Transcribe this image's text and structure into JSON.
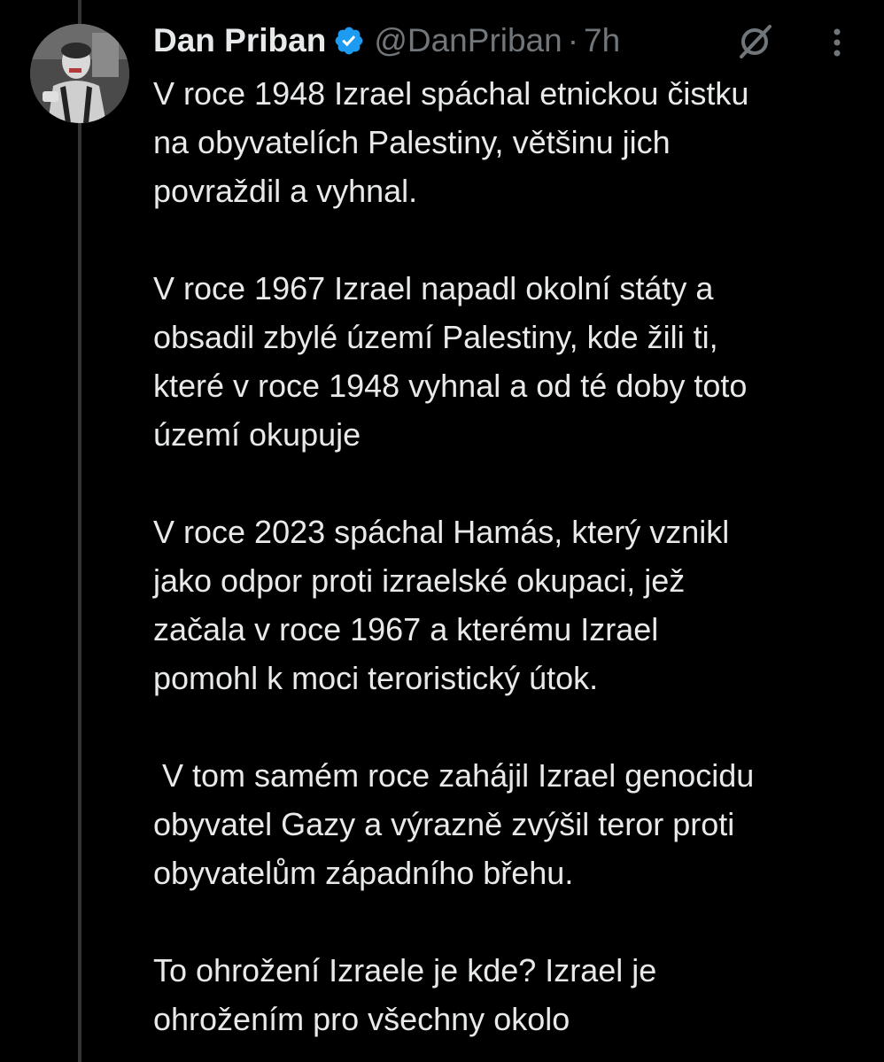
{
  "tweet": {
    "author": {
      "display_name": "Dan Priban",
      "handle": "@DanPriban",
      "verified": true,
      "avatar_icon": "profile-photo"
    },
    "separator": "·",
    "time": "7h",
    "actions": {
      "grok_icon": "grok-slash-icon",
      "more_icon": "more-vertical-icon"
    },
    "paragraphs": [
      "V roce 1948 Izrael spáchal etnickou čistku\nna obyvatelích Palestiny, většinu jich\npovraždil a vyhnal.",
      "V roce 1967 Izrael napadl okolní státy a\nobsadil zbylé území Palestiny, kde žili ti,\nkteré v roce 1948 vyhnal a od té doby toto\núzemí okupuje",
      "V roce 2023 spáchal Hamás, který vznikl\njako odpor proti izraelské okupaci, jež\nzačala v roce 1967 a kterému Izrael\npomohl k moci teroristický útok.",
      " V tom samém roce zahájil Izrael genocidu\nobyvatel Gazy a výrazně zvýšil teror proti\nobyvatelům západního břehu.",
      "To ohrožení Izraele je kde? Izrael je\nohrožením pro všechny okolo"
    ]
  },
  "colors": {
    "background": "#000000",
    "text": "#e7e9ea",
    "muted": "#71767b",
    "verified": "#1d9bf0",
    "thread_line": "#333639"
  }
}
